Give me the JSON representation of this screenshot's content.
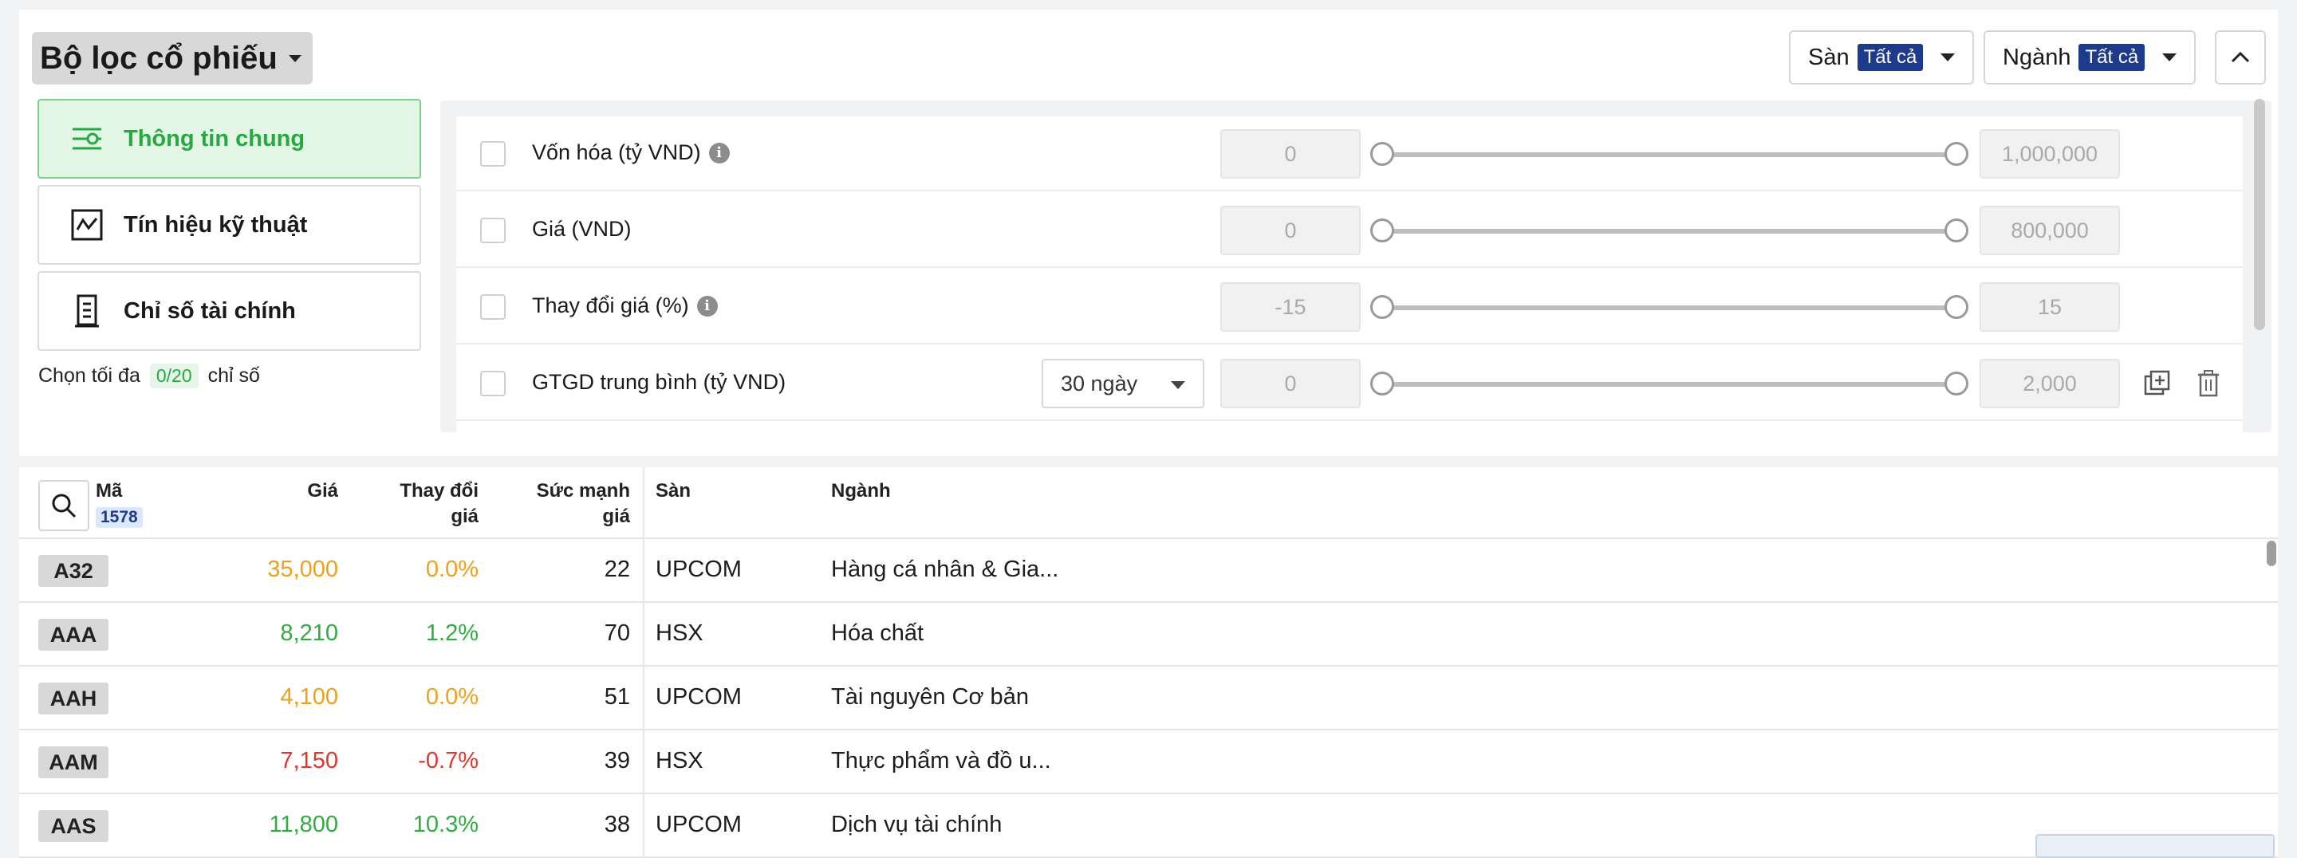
{
  "header": {
    "title": "Bộ lọc cổ phiếu",
    "exchange_filter": {
      "label": "Sàn",
      "value": "Tất cả"
    },
    "industry_filter": {
      "label": "Ngành",
      "value": "Tất cả"
    }
  },
  "tabs": [
    {
      "label": "Thông tin chung",
      "active": true,
      "icon": "filter-settings-icon"
    },
    {
      "label": "Tín hiệu kỹ thuật",
      "active": false,
      "icon": "chart-line-icon"
    },
    {
      "label": "Chỉ số tài chính",
      "active": false,
      "icon": "document-icon"
    }
  ],
  "limit": {
    "prefix": "Chọn tối đa",
    "count": "0/20",
    "suffix": "chỉ số"
  },
  "criteria": [
    {
      "label": "Vốn hóa (tỷ VND)",
      "info": true,
      "min": "0",
      "max": "1,000,000"
    },
    {
      "label": "Giá (VND)",
      "info": false,
      "min": "0",
      "max": "800,000"
    },
    {
      "label": "Thay đổi giá (%)",
      "info": true,
      "min": "-15",
      "max": "15"
    },
    {
      "label": "GTGD trung bình (tỷ VND)",
      "info": false,
      "period": "30 ngày",
      "min": "0",
      "max": "2,000"
    }
  ],
  "table": {
    "headers": {
      "symbol": "Mã",
      "count": "1578",
      "price": "Giá",
      "change_1": "Thay đổi",
      "change_2": "giá",
      "strength_1": "Sức mạnh",
      "strength_2": "giá",
      "exchange": "Sàn",
      "industry": "Ngành"
    },
    "rows": [
      {
        "symbol": "A32",
        "price": "35,000",
        "change": "0.0%",
        "strength": "22",
        "exchange": "UPCOM",
        "industry": "Hàng cá nhân & Gia...",
        "color": "#f0a11a"
      },
      {
        "symbol": "AAA",
        "price": "8,210",
        "change": "1.2%",
        "strength": "70",
        "exchange": "HSX",
        "industry": "Hóa chất",
        "color": "#2fae3f"
      },
      {
        "symbol": "AAH",
        "price": "4,100",
        "change": "0.0%",
        "strength": "51",
        "exchange": "UPCOM",
        "industry": "Tài nguyên Cơ bản",
        "color": "#f0a11a"
      },
      {
        "symbol": "AAM",
        "price": "7,150",
        "change": "-0.7%",
        "strength": "39",
        "exchange": "HSX",
        "industry": "Thực phẩm và đồ u...",
        "color": "#e0362c"
      },
      {
        "symbol": "AAS",
        "price": "11,800",
        "change": "10.3%",
        "strength": "38",
        "exchange": "UPCOM",
        "industry": "Dịch vụ tài chính",
        "color": "#2fae3f"
      }
    ]
  },
  "colors": {
    "accent_green": "#27a844",
    "badge_blue": "#1e3a8a",
    "up": "#2fae3f",
    "ref": "#f0a11a",
    "down": "#e0362c"
  }
}
